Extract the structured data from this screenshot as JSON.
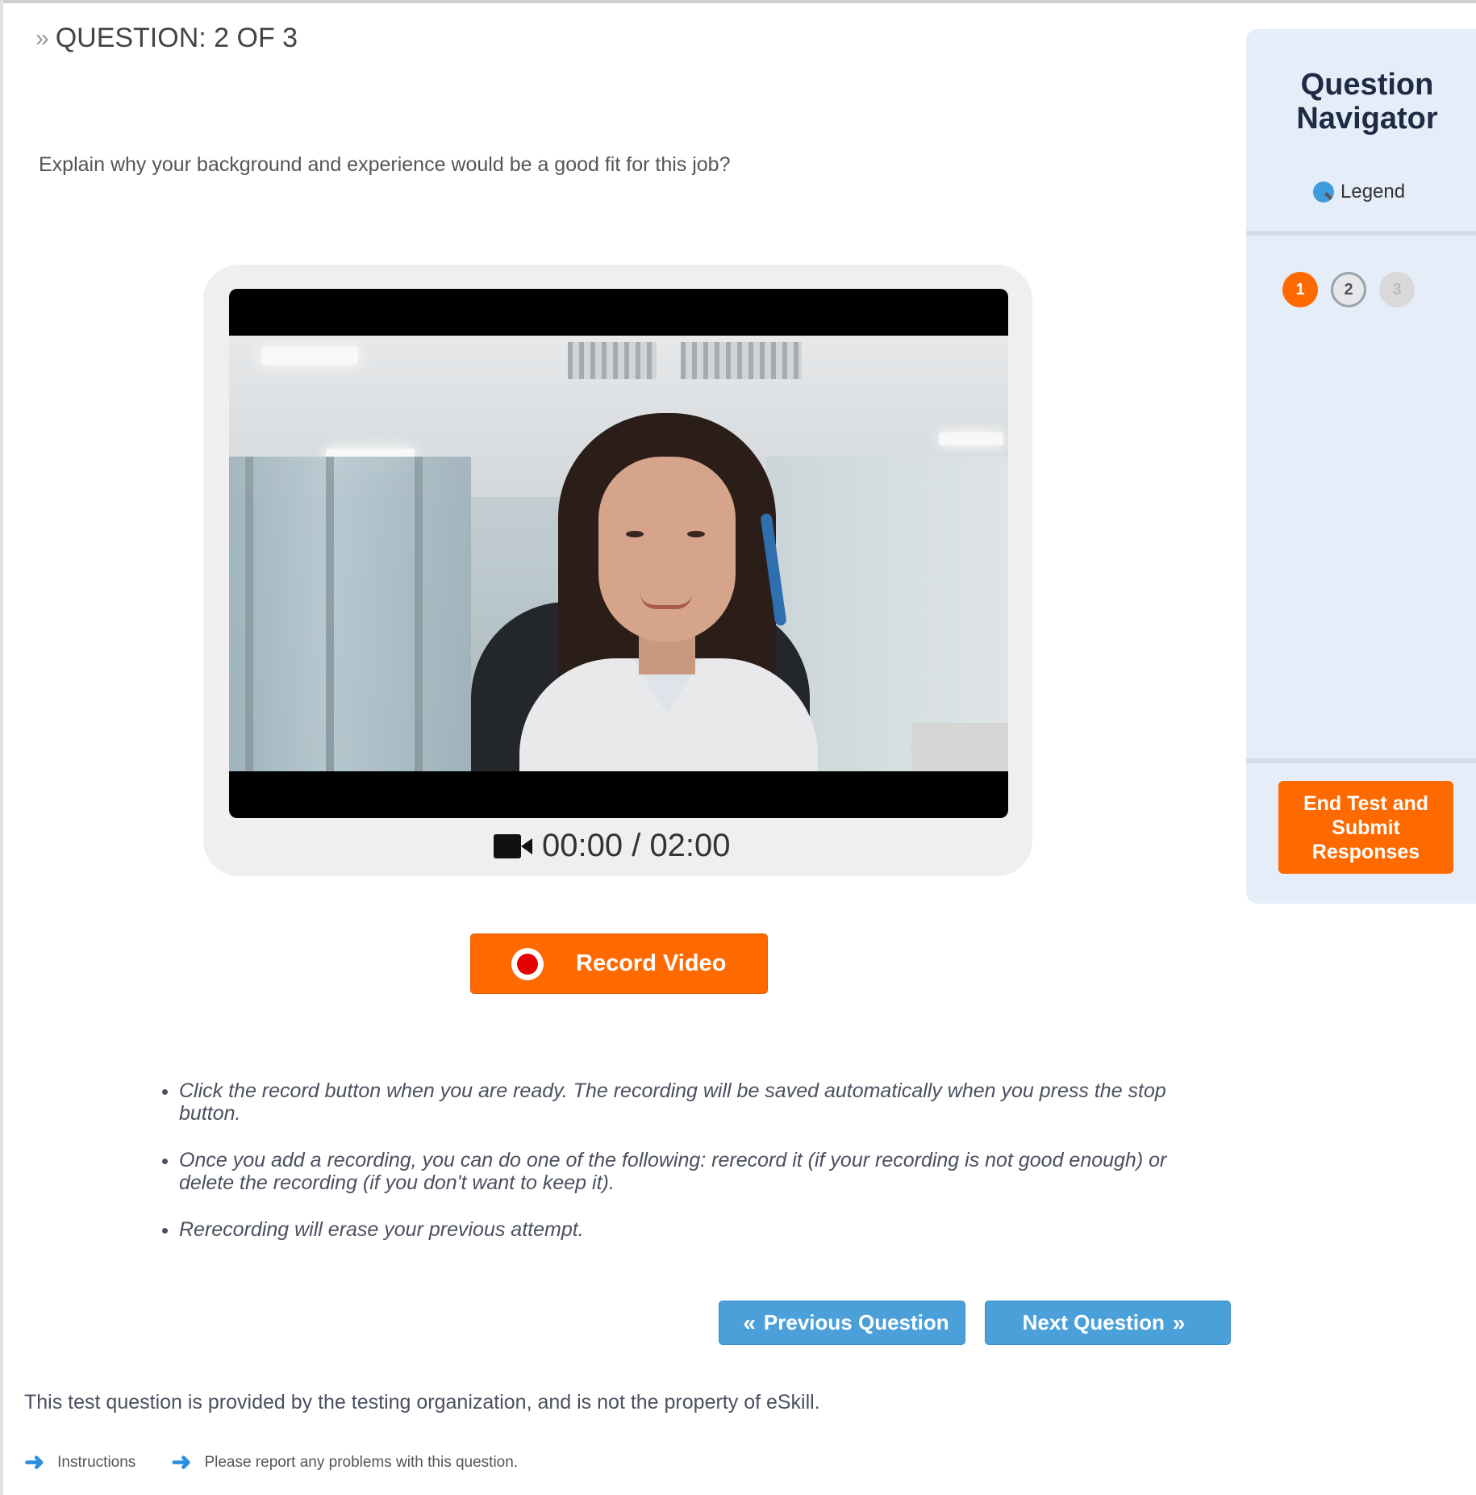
{
  "header": {
    "question_counter": "QUESTION: 2 OF 3"
  },
  "question": {
    "prompt": "Explain why your background and experience would be a good fit for this job?"
  },
  "video": {
    "timer": "00:00 / 02:00"
  },
  "actions": {
    "record_label": "Record Video",
    "prev_label": "Previous Question",
    "next_label": "Next Question"
  },
  "instructions": [
    "Click the record button when you are ready. The recording will be saved automatically when you press the stop button.",
    "Once you add a recording, you can do one of the following: rerecord it (if your recording is not good enough) or delete the recording (if you don't want to keep it).",
    "Rerecording will erase your previous attempt."
  ],
  "footer": {
    "note": "This test question is provided by the testing organization, and is not the property of eSkill.",
    "links": [
      "Instructions",
      "Please report any problems with this question."
    ]
  },
  "navigator": {
    "title_line1": "Question",
    "title_line2": "Navigator",
    "legend_label": "Legend",
    "questions": [
      "1",
      "2",
      "3"
    ],
    "end_button_label": "End Test and Submit Responses"
  },
  "colors": {
    "accent_orange": "#ff6a00",
    "nav_blue": "#4ba0d9",
    "panel_bg": "#e4edf8"
  },
  "icons": [
    "double-chevron-right-icon",
    "video-camera-icon",
    "record-dot-icon",
    "double-chevron-left-icon",
    "arrow-right-icon",
    "legend-magnifier-icon"
  ]
}
